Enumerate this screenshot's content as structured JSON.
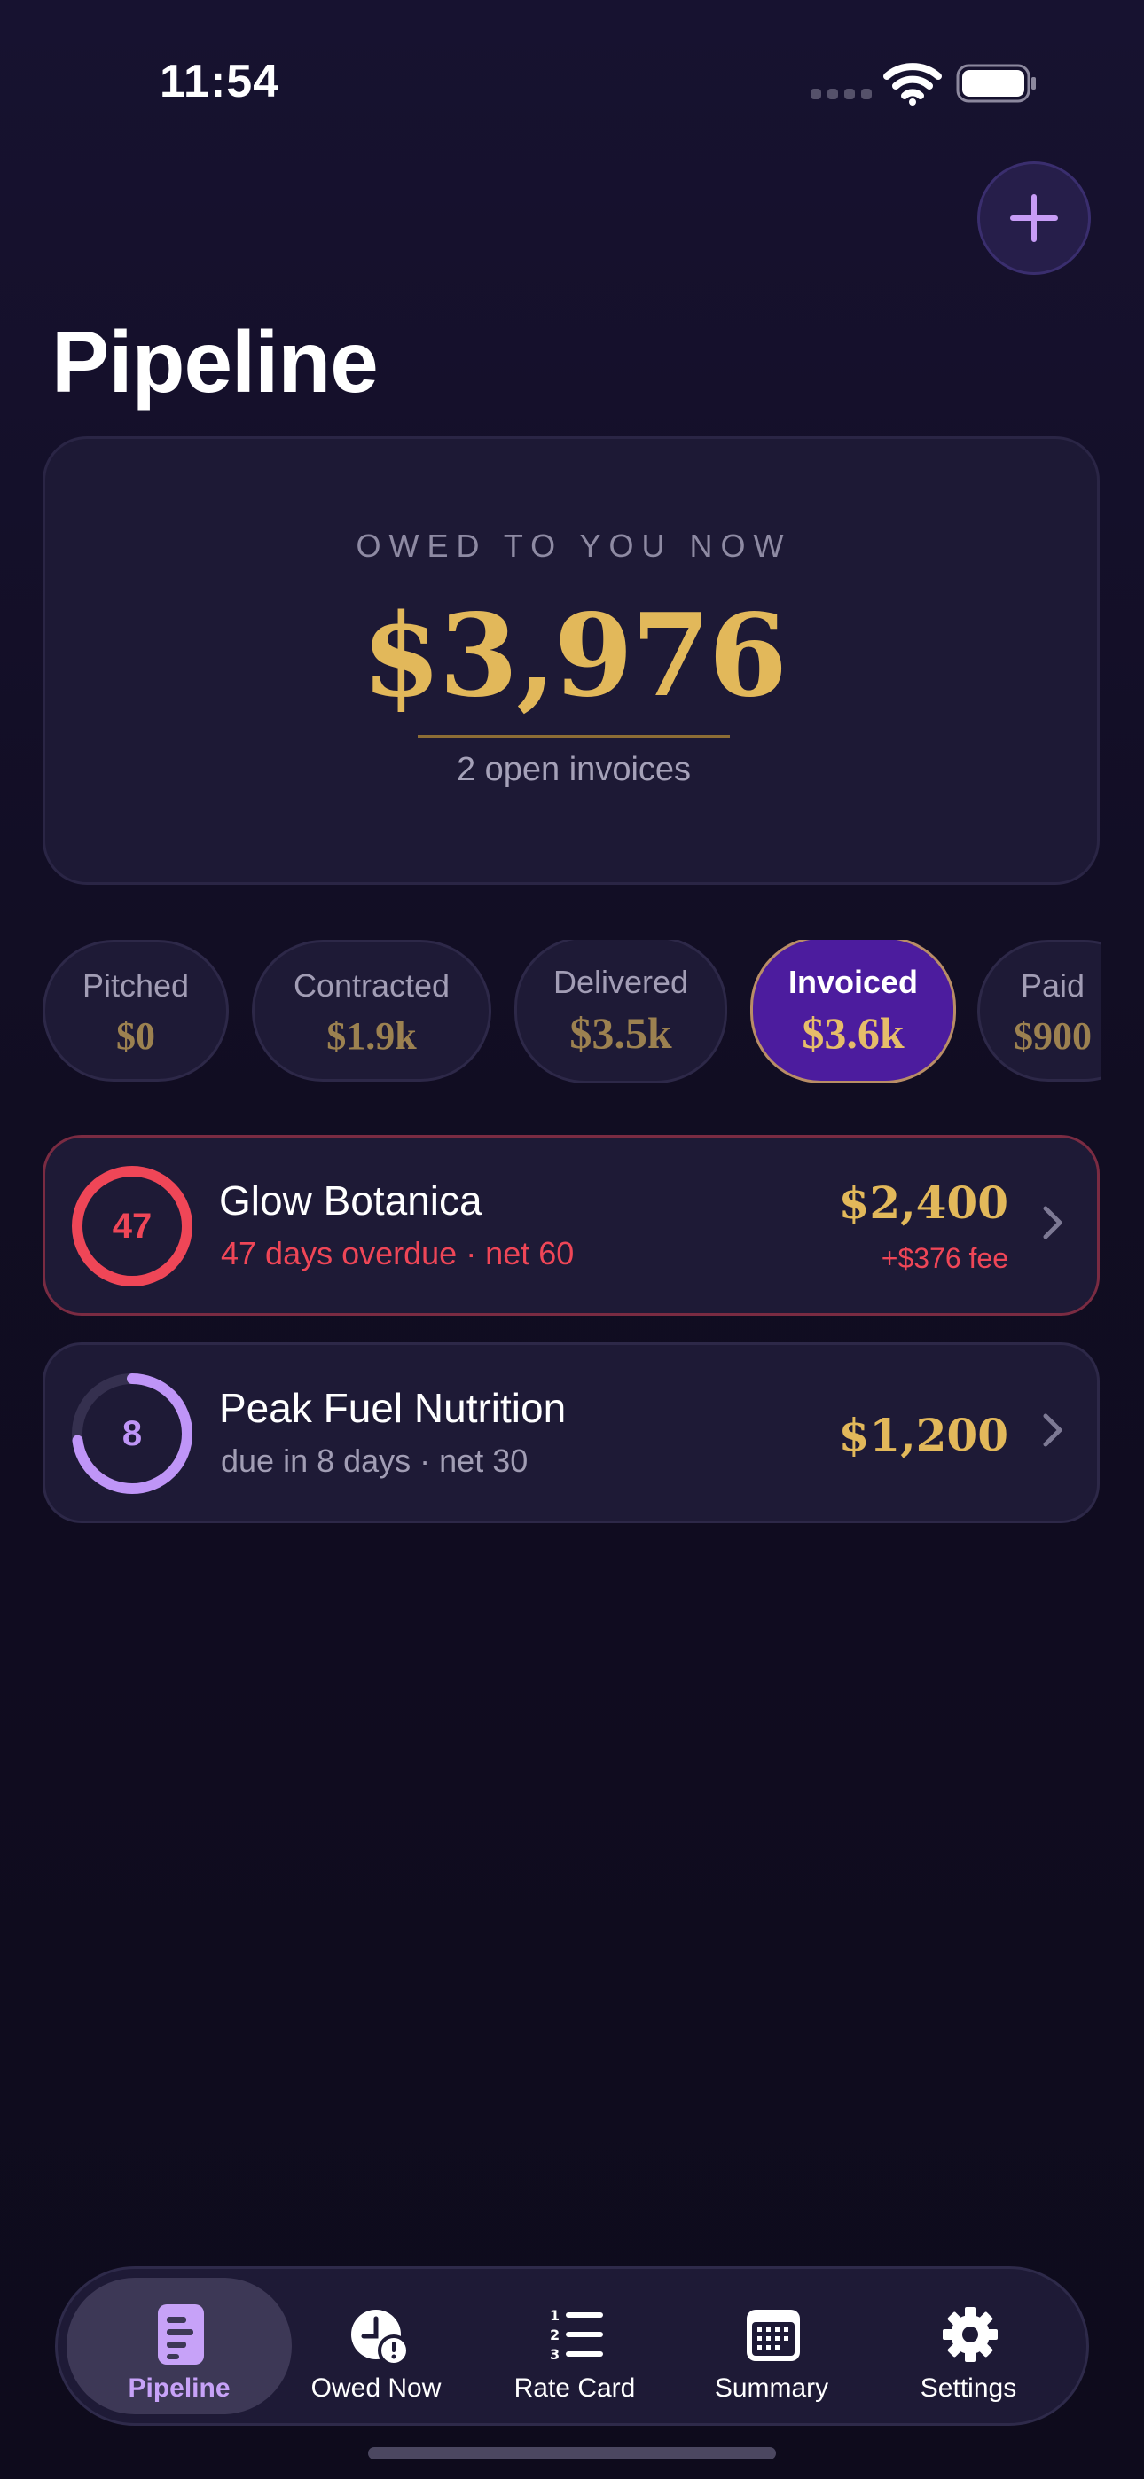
{
  "status_bar": {
    "time": "11:54"
  },
  "header": {
    "title": "Pipeline",
    "add_button": "add"
  },
  "owed_card": {
    "label": "OWED TO YOU NOW",
    "amount": "$3,976",
    "subtitle": "2 open invoices"
  },
  "stages": [
    {
      "label": "Pitched",
      "value": "$0",
      "active": false
    },
    {
      "label": "Contracted",
      "value": "$1.9k",
      "active": false
    },
    {
      "label": "Delivered",
      "value": "$3.5k",
      "active": false
    },
    {
      "label": "Invoiced",
      "value": "$3.6k",
      "active": true
    },
    {
      "label": "Paid",
      "value": "$900",
      "active": false
    }
  ],
  "invoices": [
    {
      "ring_value": "47",
      "ring_progress": 1.0,
      "client": "Glow Botanica",
      "detail": "47 days overdue · net 60",
      "amount": "$2,400",
      "fee": "+$376 fee",
      "status": "overdue"
    },
    {
      "ring_value": "8",
      "ring_progress": 0.73,
      "client": "Peak Fuel Nutrition",
      "detail": "due in 8 days · net 30",
      "amount": "$1,200",
      "fee": "",
      "status": "due"
    }
  ],
  "tabbar": {
    "tabs": [
      {
        "label": "Pipeline",
        "icon": "pipeline-doc-icon",
        "active": true
      },
      {
        "label": "Owed Now",
        "icon": "clock-alert-icon",
        "active": false
      },
      {
        "label": "Rate Card",
        "icon": "numbered-list-icon",
        "active": false
      },
      {
        "label": "Summary",
        "icon": "calendar-icon",
        "active": false
      },
      {
        "label": "Settings",
        "icon": "gear-icon",
        "active": false
      }
    ]
  },
  "colors": {
    "gold": "#e2b85a",
    "accent_purple": "#4c1c9e",
    "overdue_red": "#ef4657",
    "ring_purple": "#bf95f7"
  }
}
